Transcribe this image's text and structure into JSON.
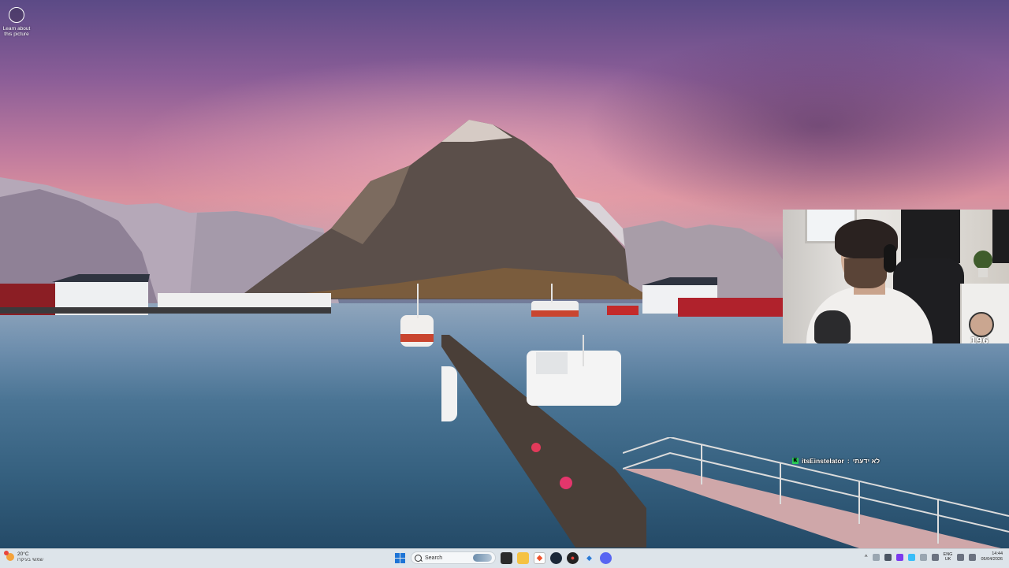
{
  "desktop": {
    "learn_label": "Learn about this picture"
  },
  "chat": {
    "username": "itsEinstelator",
    "separator": " : ",
    "message": "לא ידעתי"
  },
  "webcam": {
    "overlay_text": "196"
  },
  "taskbar": {
    "weather_temp": "20°C",
    "weather_text": "שמשי בעיקרו",
    "search_placeholder": "Search",
    "lang_line1": "ENG",
    "lang_line2": "UK",
    "time": "14:44",
    "date": "05/04/2026"
  },
  "colors": {
    "taskbar_bg": "#dde4ea",
    "chat_badge": "#2bd157",
    "accent": "#1d74d6"
  }
}
